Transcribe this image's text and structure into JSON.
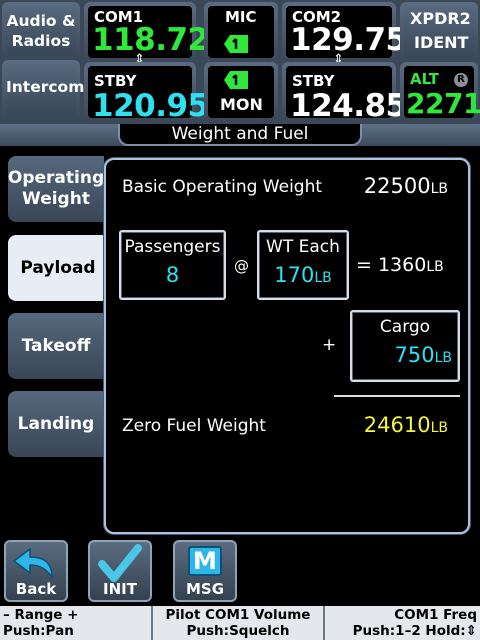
{
  "header": {
    "audio_radios": "Audio &\nRadios",
    "intercom": "Intercom",
    "com1": {
      "label": "COM1",
      "active": "118.72",
      "stby_label": "STBY",
      "stby": "120.95"
    },
    "mic": {
      "label": "MIC",
      "mon_label": "MON"
    },
    "com2": {
      "label": "COM2",
      "active": "129.75",
      "stby_label": "STBY",
      "stby": "124.85"
    },
    "xpdr": {
      "label": "XPDR2",
      "ident": "IDENT",
      "alt_label": "ALT",
      "alt_badge": "R",
      "code": "2271"
    }
  },
  "page_title": "Weight and Fuel",
  "tabs": [
    {
      "label": "Operating\nWeight",
      "active": false
    },
    {
      "label": "Payload",
      "active": true
    },
    {
      "label": "Takeoff",
      "active": false
    },
    {
      "label": "Landing",
      "active": false
    }
  ],
  "payload": {
    "basic_label": "Basic Operating Weight",
    "basic_value": "22500",
    "unit": "LB",
    "passengers_label": "Passengers",
    "passengers_value": "8",
    "at": "@",
    "wt_each_label": "WT Each",
    "wt_each_value": "170",
    "equals": "= 1360",
    "plus": "+",
    "cargo_label": "Cargo",
    "cargo_value": "750",
    "zfw_label": "Zero Fuel Weight",
    "zfw_value": "24610"
  },
  "softkeys": {
    "back": "Back",
    "init": "INIT",
    "msg": "MSG",
    "msg_icon_letter": "M"
  },
  "status_bar": {
    "left_top": "– Range +",
    "left_bottom": "Push:Pan",
    "mid_top": "Pilot COM1 Volume",
    "mid_bottom": "Push:Squelch",
    "right_top": "COM1 Freq",
    "right_bottom": "Push:1–2 Hold:⇕"
  },
  "colors": {
    "active_freq": "#2ee83a",
    "standby_freq": "#2fe0f0",
    "zfw": "#f5f53a"
  }
}
